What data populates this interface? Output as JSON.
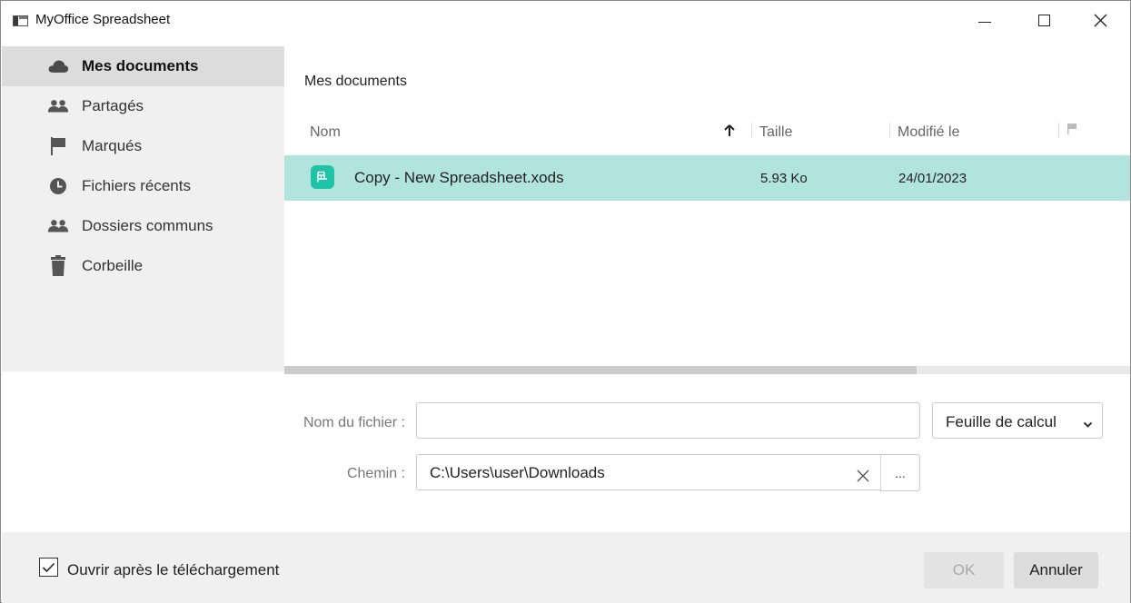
{
  "window": {
    "title": "MyOffice Spreadsheet",
    "controls": [
      "minimize",
      "maximize",
      "close"
    ]
  },
  "sidebar": {
    "items": [
      {
        "label": "Mes documents",
        "icon": "cloud-icon",
        "active": true
      },
      {
        "label": "Partagés",
        "icon": "users-icon",
        "active": false
      },
      {
        "label": "Marqués",
        "icon": "flag-icon",
        "active": false
      },
      {
        "label": "Fichiers récents",
        "icon": "clock-icon",
        "active": false
      },
      {
        "label": "Dossiers communs",
        "icon": "users-icon",
        "active": false
      },
      {
        "label": "Corbeille",
        "icon": "trash-icon",
        "active": false
      }
    ]
  },
  "main": {
    "breadcrumb": "Mes documents",
    "columns": {
      "name": "Nom",
      "size": "Taille",
      "modified": "Modifié le"
    },
    "sort": {
      "column": "name",
      "direction": "ascending"
    },
    "files": [
      {
        "name": "Copy - New Spreadsheet.xods",
        "size": "5.93 Ko",
        "modified": "24/01/2023",
        "selected": true
      }
    ]
  },
  "form": {
    "filename_label": "Nom du fichier :",
    "filename_value": "",
    "filetype_value": "Feuille de calcul",
    "path_label": "Chemin :",
    "path_value": "C:\\Users\\user\\Downloads",
    "browse_label": "..."
  },
  "footer": {
    "open_after_label": "Ouvrir après le téléchargement",
    "open_after_checked": true,
    "ok_label": "OK",
    "cancel_label": "Annuler"
  },
  "colors": {
    "selected_row": "#b1e4dc",
    "file_icon": "#20c3a5",
    "sidebar_bg": "#f0f0f0",
    "sidebar_active": "#dcdcdc"
  }
}
